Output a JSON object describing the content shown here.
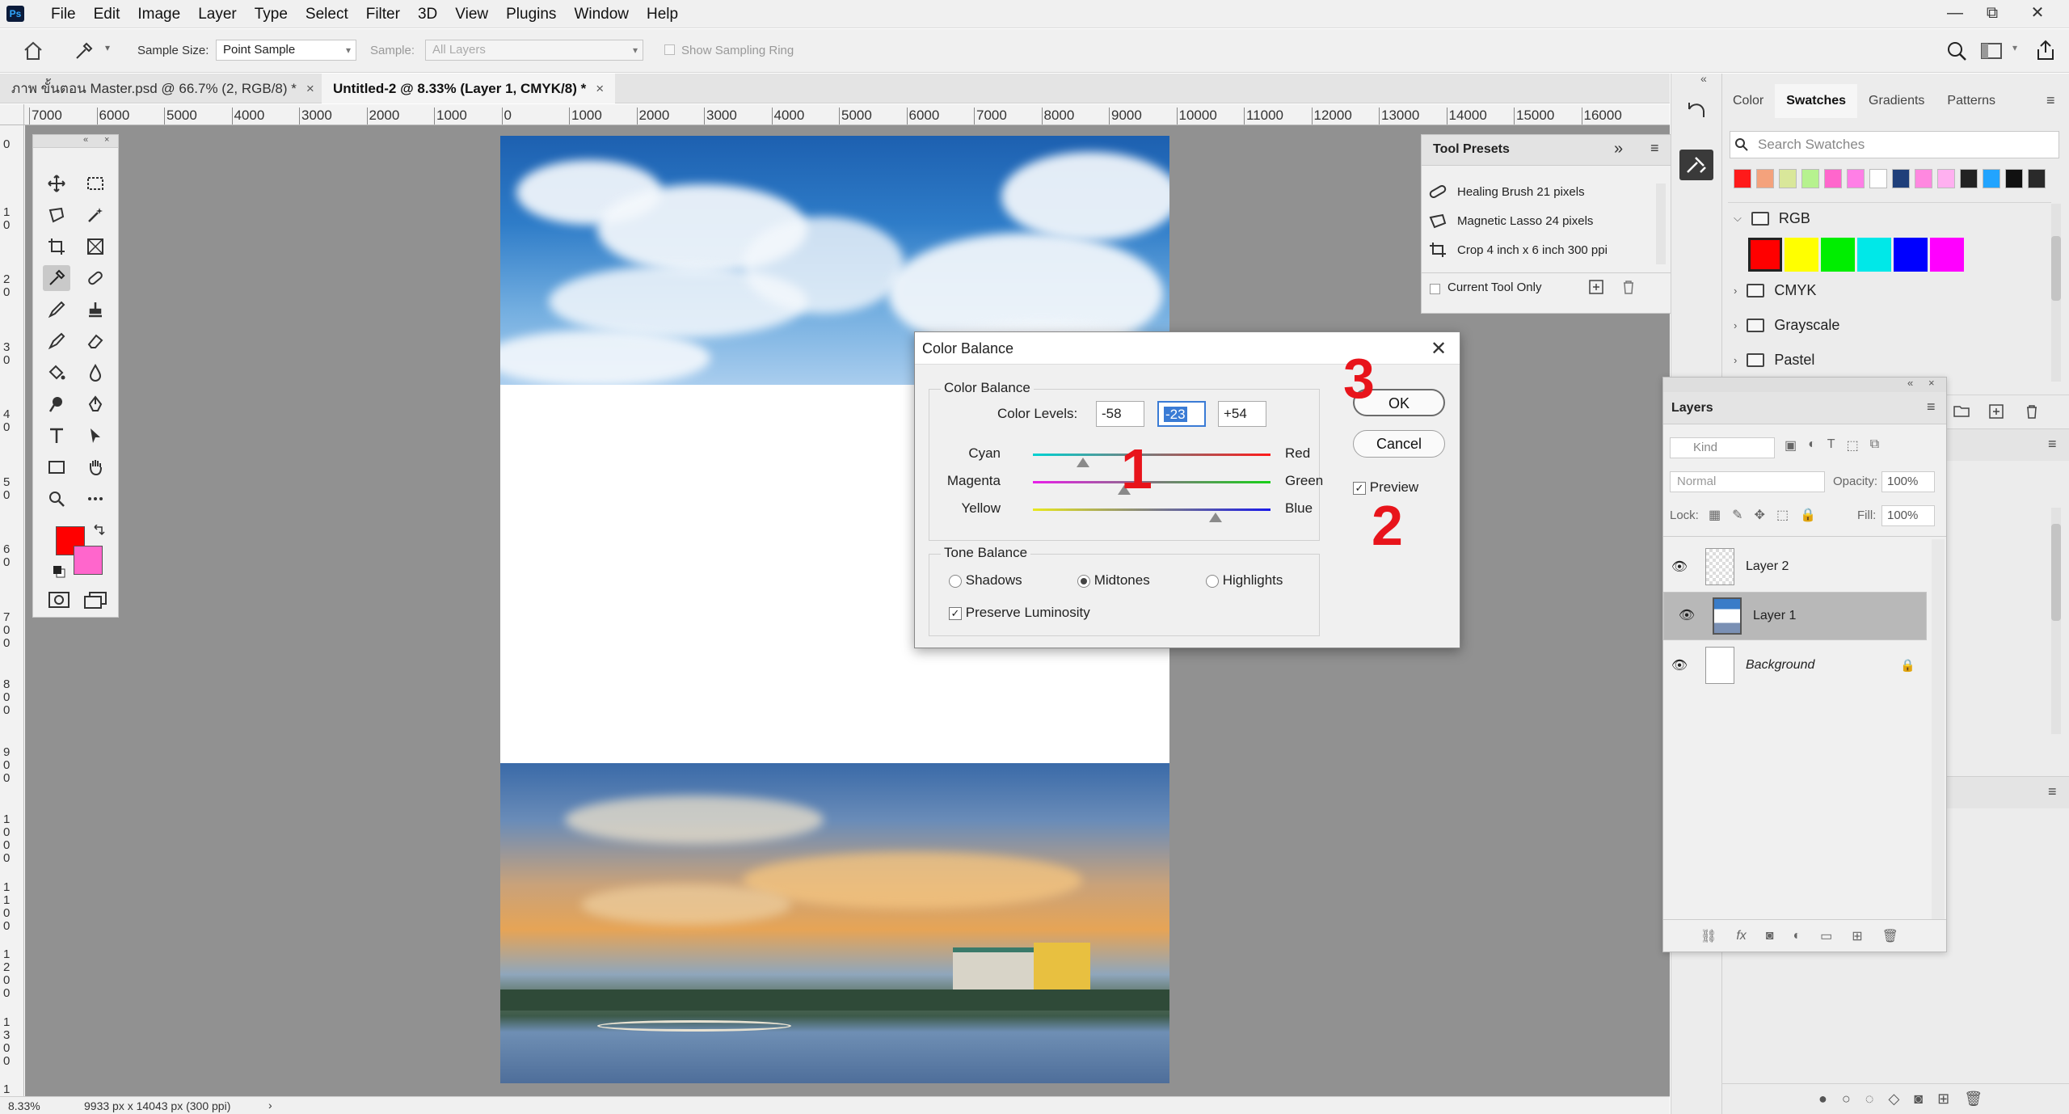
{
  "app": {
    "logo": "Ps"
  },
  "menu": [
    "File",
    "Edit",
    "Image",
    "Layer",
    "Type",
    "Select",
    "Filter",
    "3D",
    "View",
    "Plugins",
    "Window",
    "Help"
  ],
  "window_controls": {
    "minimize": "—",
    "restore": "⧉",
    "close": "✕"
  },
  "options_bar": {
    "sample_size_label": "Sample Size:",
    "sample_size_value": "Point Sample",
    "sample_label": "Sample:",
    "sample_value": "All Layers",
    "show_sampling_ring": "Show Sampling Ring"
  },
  "tabs": [
    {
      "label": "ภาพ ขั้นตอน Master.psd @ 66.7% (2, RGB/8) *",
      "close": "×"
    },
    {
      "label": "Untitled-2 @ 8.33% (Layer 1, CMYK/8) *",
      "close": "×"
    }
  ],
  "ruler_h": [
    "7000",
    "6000",
    "5000",
    "4000",
    "3000",
    "2000",
    "1000",
    "0",
    "1000",
    "2000",
    "3000",
    "4000",
    "5000",
    "6000",
    "7000",
    "8000",
    "9000",
    "10000",
    "11000",
    "12000",
    "13000",
    "14000",
    "15000",
    "16000"
  ],
  "ruler_v": [
    "0",
    "1 0",
    "2 0",
    "3 0",
    "4 0",
    "5 0",
    "6 0",
    "7 0 0",
    "8 0 0",
    "9 0 0",
    "1 0 0 0",
    "1 1 0 0",
    "1 2 0 0",
    "1 3 0 0",
    "1 4 0 0"
  ],
  "status": {
    "zoom": "8.33%",
    "doc_info": "9933 px x 14043 px (300 ppi)",
    "arrow": "›"
  },
  "tool_presets": {
    "title": "Tool Presets",
    "items": [
      "Healing Brush 21 pixels",
      "Magnetic Lasso 24 pixels",
      "Crop 4 inch x 6 inch 300 ppi"
    ],
    "current_tool_only": "Current Tool Only"
  },
  "color_balance": {
    "title": "Color Balance",
    "section_label": "Color Balance",
    "levels_label": "Color Levels:",
    "levels": [
      "-58",
      "-23",
      "+54"
    ],
    "sliders": [
      {
        "left": "Cyan",
        "right": "Red",
        "value": -58
      },
      {
        "left": "Magenta",
        "right": "Green",
        "value": -23
      },
      {
        "left": "Yellow",
        "right": "Blue",
        "value": 54
      }
    ],
    "tone_label": "Tone Balance",
    "tones": [
      "Shadows",
      "Midtones",
      "Highlights"
    ],
    "tone_selected": "Midtones",
    "preserve": "Preserve Luminosity",
    "ok": "OK",
    "cancel": "Cancel",
    "preview": "Preview"
  },
  "annotations": [
    "1",
    "2",
    "3"
  ],
  "swatches_panel": {
    "tabs": [
      "Color",
      "Swatches",
      "Gradients",
      "Patterns"
    ],
    "active_tab": "Swatches",
    "search_placeholder": "Search Swatches",
    "recent": [
      "#ff1a1a",
      "#f4a27c",
      "#d9e79a",
      "#b6f28f",
      "#ff66cc",
      "#ff7fe6",
      "#ffffff",
      "#1f3f7a",
      "#ff88e0",
      "#ffb0f0",
      "#222222",
      "#22a4ff",
      "#111111",
      "#2a2a2a"
    ],
    "folders": [
      "RGB",
      "CMYK",
      "Grayscale",
      "Pastel"
    ],
    "rgb_swatches": [
      "#ff0000",
      "#ffff00",
      "#00ee00",
      "#00e8e8",
      "#0000ff",
      "#ff00ff"
    ]
  },
  "layers_panel": {
    "title": "Layers",
    "kind": "Kind",
    "blend": "Normal",
    "opacity_label": "Opacity:",
    "opacity": "100%",
    "lock_label": "Lock:",
    "fill_label": "Fill:",
    "fill": "100%",
    "layers": [
      "Layer 2",
      "Layer 1",
      "Background"
    ],
    "selected": "Layer 1"
  }
}
